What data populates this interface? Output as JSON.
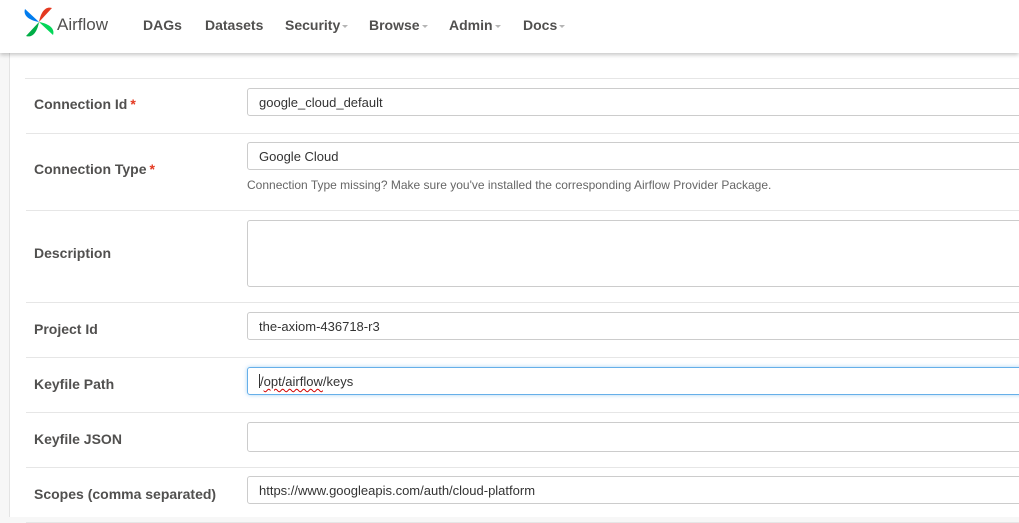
{
  "navbar": {
    "brand": "Airflow",
    "items": [
      {
        "label": "DAGs",
        "dropdown": false
      },
      {
        "label": "Datasets",
        "dropdown": false
      },
      {
        "label": "Security",
        "dropdown": true
      },
      {
        "label": "Browse",
        "dropdown": true
      },
      {
        "label": "Admin",
        "dropdown": true
      },
      {
        "label": "Docs",
        "dropdown": true
      }
    ]
  },
  "form": {
    "connection_id": {
      "label": "Connection Id",
      "required_mark": "*",
      "value": "google_cloud_default"
    },
    "connection_type": {
      "label": "Connection Type",
      "required_mark": "*",
      "value": "Google Cloud",
      "help": "Connection Type missing? Make sure you've installed the corresponding Airflow Provider Package."
    },
    "description": {
      "label": "Description",
      "value": ""
    },
    "project_id": {
      "label": "Project Id",
      "value": "the-axiom-436718-r3"
    },
    "keyfile_path": {
      "label": "Keyfile Path",
      "value_prefix": "/",
      "value_misspelled": "opt/airflow",
      "value_suffix": "/keys"
    },
    "keyfile_json": {
      "label": "Keyfile JSON",
      "value": ""
    },
    "scopes": {
      "label": "Scopes (comma separated)",
      "value": "https://www.googleapis.com/auth/cloud-platform"
    }
  },
  "colors": {
    "required": "#e43921",
    "focus_border": "#66afe9",
    "logo_blue": "#017cee",
    "logo_red": "#e43921",
    "logo_green": "#00ad46",
    "logo_teal": "#04d659"
  }
}
